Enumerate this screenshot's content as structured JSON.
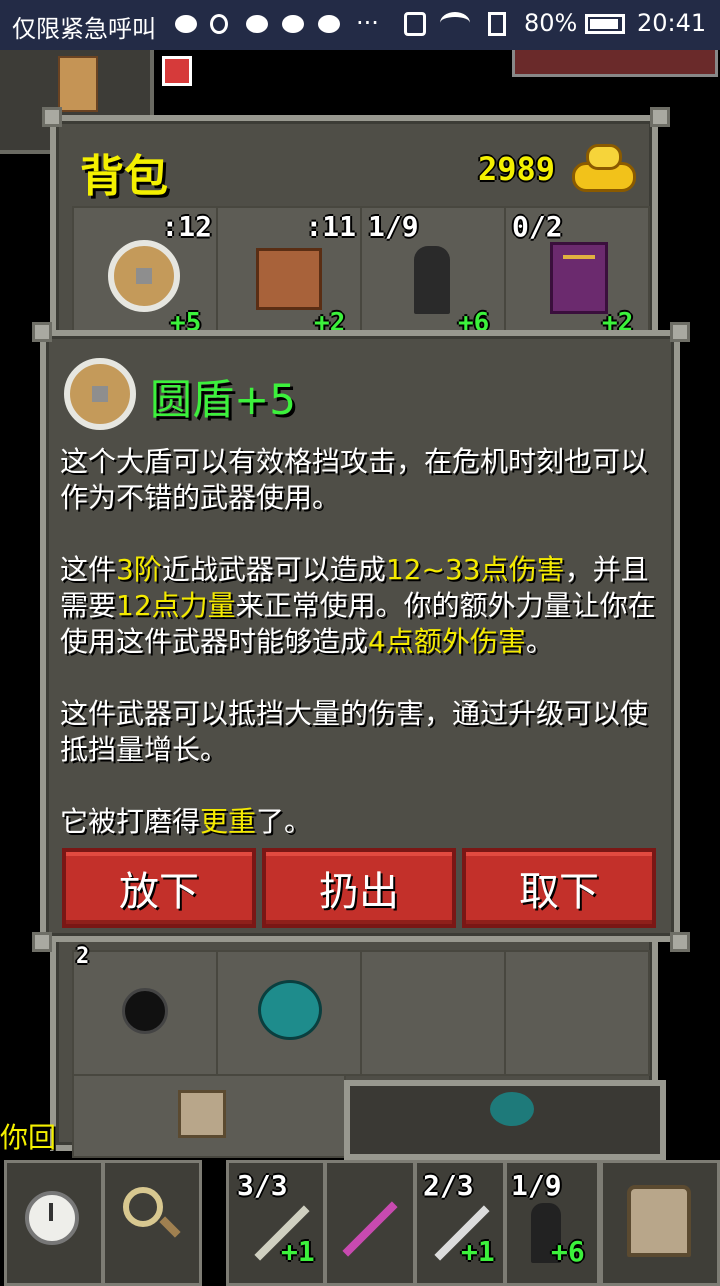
{
  "statusbar": {
    "left_text": "仅限紧急呼叫",
    "battery": "80%",
    "time": "20:41",
    "dots": "···",
    "icons": [
      "wechat-icon",
      "weibo-icon",
      "wechat-icon",
      "wechat-icon",
      "wechat-icon",
      "mute-icon",
      "wifi-icon",
      "sim-icon",
      "battery-icon"
    ]
  },
  "backpack": {
    "title": "背包",
    "gold": "2989",
    "items": [
      {
        "top": ":12",
        "bottom": "+5",
        "icon": "round-shield-icon"
      },
      {
        "top": ":11",
        "bottom": "+2",
        "icon": "leather-armor-icon"
      },
      {
        "top": "1/9",
        "bottom": "+6",
        "icon": "cloak-icon"
      },
      {
        "top": "0/2",
        "bottom": "+2",
        "icon": "spellbook-icon"
      }
    ],
    "lower_items": [
      {
        "top": "2",
        "icon": "bomb-icon"
      },
      {
        "top": "",
        "icon": "seed-pouch-icon"
      }
    ]
  },
  "item_info": {
    "name": "圆盾+5",
    "para1": "这个大盾可以有效格挡攻击，在危机时刻也可以作为不错的武器使用。",
    "para2_parts": [
      "这件",
      "3阶",
      "近战武器可以造成",
      "12~33点伤害",
      "，并且需要",
      "12点力量",
      "来正常使用。你的额外力量让你在使用这件武器时能够造成",
      "4点额外伤害",
      "。"
    ],
    "para3": "这件武器可以抵挡大量的伤害，通过升级可以使抵挡量增长。",
    "para4_parts": [
      "它被打磨得",
      "更重",
      "了。"
    ],
    "buttons": [
      "放下",
      "扔出",
      "取下"
    ]
  },
  "log": {
    "partial": "你回"
  },
  "toolbar": {
    "quickslots": [
      {
        "top": "3/3",
        "bottom": "+1",
        "icon": "wand-icon"
      },
      {
        "top": "",
        "bottom": "",
        "icon": "wand-icon"
      },
      {
        "top": "2/3",
        "bottom": "+1",
        "icon": "wand-icon"
      },
      {
        "top": "1/9",
        "bottom": "+6",
        "icon": "cloak-icon"
      }
    ]
  },
  "colors": {
    "panel": "#4f4e47",
    "button": "#c3302a",
    "gold": "#f4f000",
    "green": "#3cf13c"
  }
}
